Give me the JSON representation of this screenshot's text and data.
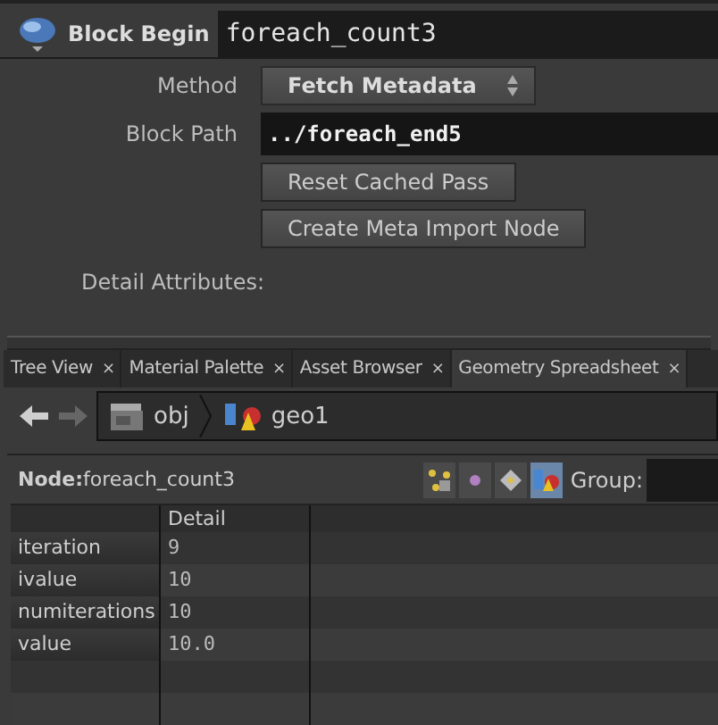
{
  "header": {
    "label": "Block Begin",
    "node_name": "foreach_count3"
  },
  "parameters": [
    {
      "kind": "menu",
      "label": "Method",
      "value": "Fetch Metadata"
    },
    {
      "kind": "field",
      "label": "Block Path",
      "value": "../foreach_end5"
    },
    {
      "kind": "button",
      "value": "Reset Cached Pass"
    },
    {
      "kind": "button",
      "value": "Create Meta Import Node"
    },
    {
      "kind": "heading",
      "label": "Detail Attributes:"
    }
  ],
  "tabs": [
    {
      "label": "Tree View",
      "selected": false,
      "close": "×"
    },
    {
      "label": "Material Palette",
      "selected": false,
      "close": "×"
    },
    {
      "label": "Asset Browser",
      "selected": false,
      "close": "×"
    },
    {
      "label": "Geometry Spreadsheet",
      "selected": true,
      "close": "×"
    }
  ],
  "path": [
    {
      "label": "obj",
      "kind": "folder"
    },
    {
      "label": "geo1",
      "kind": "geo"
    }
  ],
  "node_bar": {
    "label": "Node:",
    "value": "foreach_count3",
    "group_label": "Group:",
    "modes": [
      {
        "kind": "points",
        "selected": false
      },
      {
        "kind": "vertices",
        "selected": false
      },
      {
        "kind": "primitives",
        "selected": false
      },
      {
        "kind": "detail",
        "selected": true
      }
    ]
  },
  "table": {
    "columns": [
      "Detail"
    ],
    "rows": [
      {
        "name": "iteration",
        "value": "9"
      },
      {
        "name": "ivalue",
        "value": "10"
      },
      {
        "name": "numiterations",
        "value": "10"
      },
      {
        "name": "value",
        "value": "10.0"
      }
    ]
  }
}
